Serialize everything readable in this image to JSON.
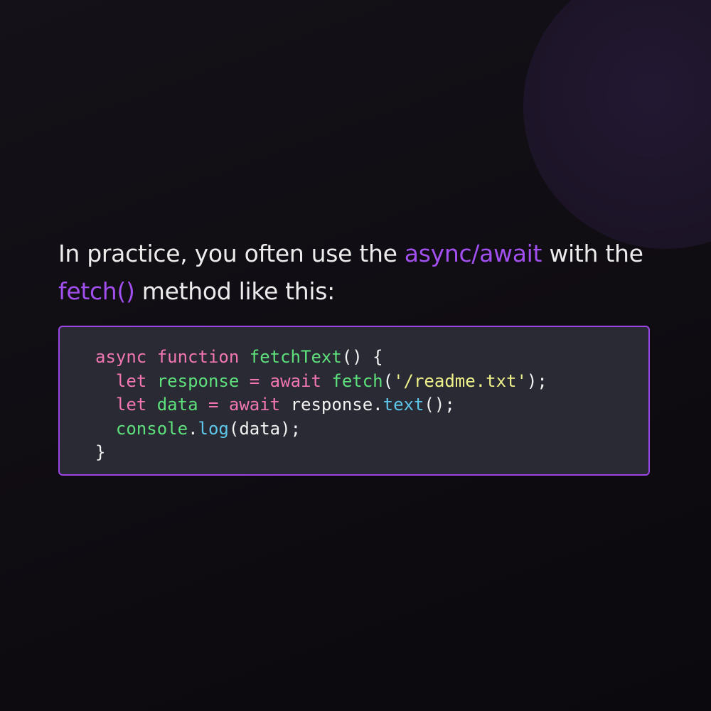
{
  "intro": {
    "part1": "In practice, you often use the ",
    "accent1": "async/await",
    "part2": " with the ",
    "accent2": "fetch()",
    "part3": " method like this:"
  },
  "code": {
    "line1": {
      "kw_async": "async",
      "sp1": " ",
      "kw_function": "function",
      "sp2": " ",
      "fn_name": "fetchText",
      "rest": "() {"
    },
    "line2": {
      "indent": "  ",
      "kw_let": "let",
      "sp1": " ",
      "var": "response",
      "sp2": " ",
      "op": "=",
      "sp3": " ",
      "kw_await": "await",
      "sp4": " ",
      "fn_fetch": "fetch",
      "open": "(",
      "str": "'/readme.txt'",
      "close": ");"
    },
    "line3": {
      "indent": "  ",
      "kw_let": "let",
      "sp1": " ",
      "var": "data",
      "sp2": " ",
      "op": "=",
      "sp3": " ",
      "kw_await": "await",
      "sp4": " ",
      "obj": "response",
      "dot": ".",
      "method": "text",
      "close": "();"
    },
    "line4": {
      "indent": "  ",
      "obj": "console",
      "dot": ".",
      "method": "log",
      "args": "(data);"
    },
    "line5": {
      "brace": "}"
    }
  },
  "colors": {
    "accent": "#a24ff0",
    "border": "#9b45e4",
    "keyword": "#f276b2",
    "function": "#5ee07c",
    "string": "#eef08a",
    "method": "#5ec6ea"
  }
}
